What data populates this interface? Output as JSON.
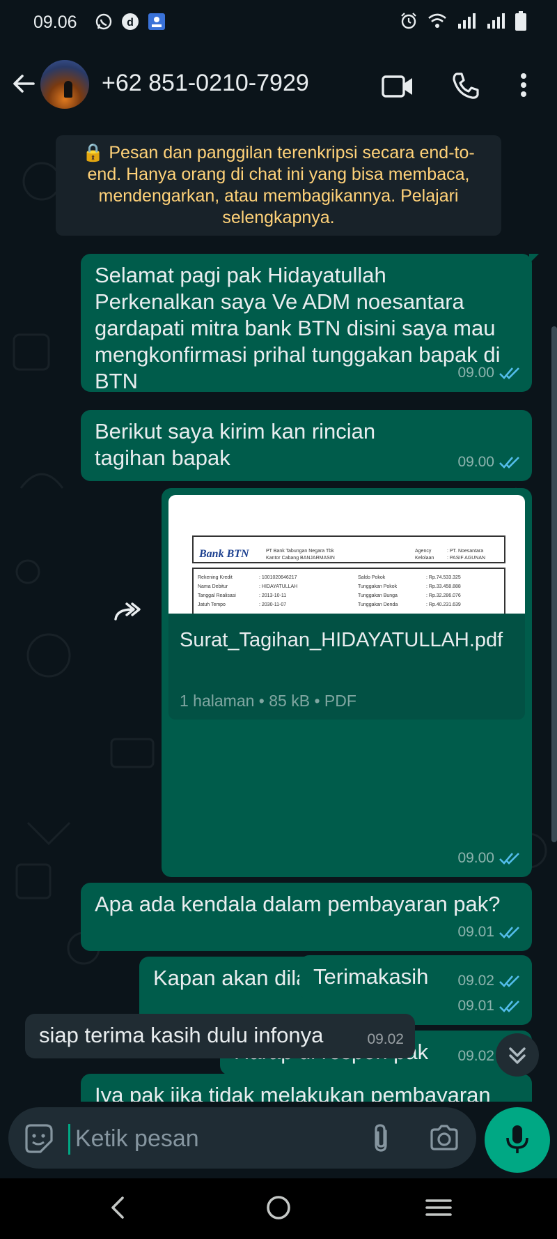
{
  "status_bar": {
    "time": "09.06"
  },
  "header": {
    "contact_name": "+62 851-0210-7929"
  },
  "encryption_notice": "🔒 Pesan dan panggilan terenkripsi secara end-to-end. Hanya orang di chat ini yang bisa membaca, mendengarkan, atau membagikannya. Pelajari selengkapnya.",
  "messages": [
    {
      "dir": "out",
      "text": "Selamat pagi pak Hidayatullah\nPerkenalkan saya Ve ADM noesantara gardapati mitra bank BTN disini saya mau mengkonfirmasi prihal tunggakan bapak di BTN",
      "time": "09.00"
    },
    {
      "dir": "out",
      "text": "Berikut saya kirim kan rincian tagihan bapak",
      "time": "09.00"
    },
    {
      "dir": "out",
      "type": "document",
      "time": "09.00"
    },
    {
      "dir": "out",
      "text": "Apa ada kendala dalam pembayaran pak?",
      "time": "09.01"
    },
    {
      "dir": "out",
      "text": "Kapan akan dilakukan pembayaran?",
      "time": "09.01"
    },
    {
      "dir": "out",
      "text": "Harap di respon pak",
      "time": "09.02"
    },
    {
      "dir": "out",
      "text": "Terimakasih",
      "time": "09.02"
    },
    {
      "dir": "in",
      "text": "siap terima kasih dulu infonya",
      "time": "09.02"
    },
    {
      "dir": "out",
      "text": "Iya pak jika tidak melakukan pembayaran",
      "time": ""
    }
  ],
  "document": {
    "filename": "Surat_Tagihan_HIDAYATULLAH.pdf",
    "meta": "1 halaman • 85 kB • PDF",
    "preview": {
      "bank_logo": "Bank BTN",
      "bank_name_1": "PT Bank Tabungan Negara Tbk",
      "bank_name_2": "Kantor Cabang BANJARMASIN",
      "agency_label": "Agency",
      "agency_value": ": PT. Noesantara",
      "kelolaan_label": "Kelolaan",
      "kelolaan_value": ": PASIF AGUNAN",
      "rows": [
        {
          "l1": "Rekening Kredit",
          "v1": ": 1001020646217",
          "l2": "Saldo Pokok",
          "v2": ": Rp.74.533.325"
        },
        {
          "l1": "Nama Debitur",
          "v1": ": HIDAYATULLAH",
          "l2": "Tunggakan Pokok",
          "v2": ": Rp.33.458.888"
        },
        {
          "l1": "Tanggal Realisasi",
          "v1": ": 2013-10-11",
          "l2": "Tunggakan Bunga",
          "v2": ": Rp.32.286.076"
        },
        {
          "l1": "Jatuh Tempo",
          "v1": ": 2030-11-07",
          "l2": "Tunggakan Denda",
          "v2": ": Rp.40.231.639"
        }
      ]
    }
  },
  "input": {
    "placeholder": "Ketik pesan"
  },
  "colors": {
    "outgoing": "#005c4b",
    "incoming": "#202c33",
    "accent": "#00a884",
    "read_tick": "#53bdeb",
    "notice_text": "#ffd279"
  },
  "icons": [
    "back-arrow-icon",
    "video-call-icon",
    "phone-icon",
    "more-vert-icon",
    "forward-icon",
    "double-tick-icon",
    "scroll-down-icon",
    "sticker-icon",
    "attach-icon",
    "camera-icon",
    "mic-icon"
  ]
}
